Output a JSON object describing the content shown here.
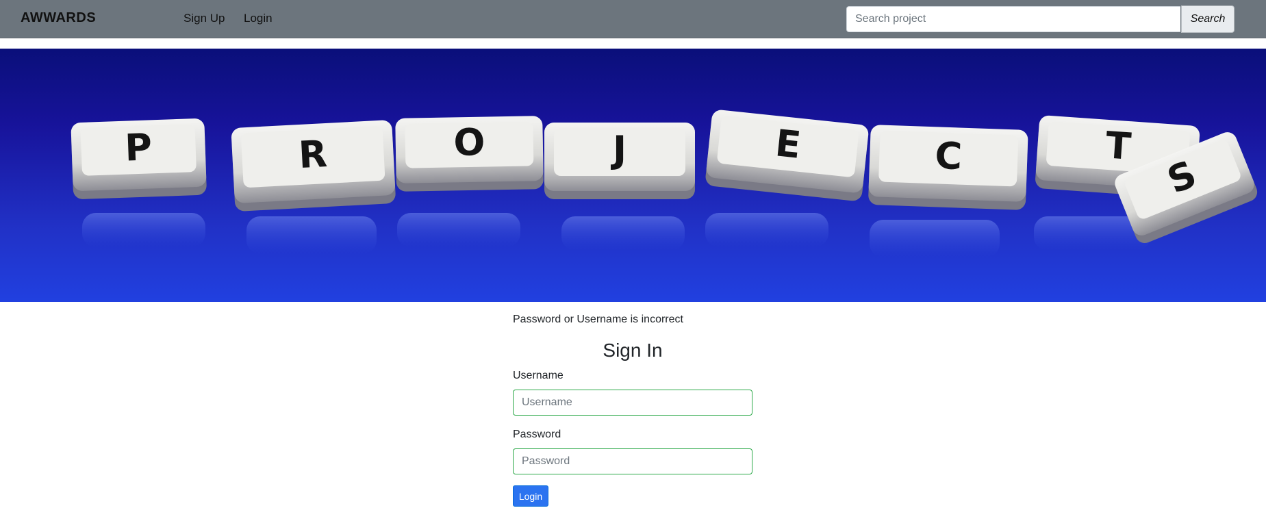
{
  "navbar": {
    "brand": "AWWARDS",
    "links": [
      {
        "label": "Sign Up"
      },
      {
        "label": "Login"
      }
    ],
    "search": {
      "placeholder": "Search project",
      "value": "",
      "button_label": "Search"
    }
  },
  "hero": {
    "keys": [
      "P",
      "R",
      "O",
      "J",
      "E",
      "C",
      "T",
      "S"
    ]
  },
  "form": {
    "error_message": "Password or Username is incorrect",
    "title": "Sign In",
    "username": {
      "label": "Username",
      "placeholder": "Username",
      "value": ""
    },
    "password": {
      "label": "Password",
      "placeholder": "Password",
      "value": ""
    },
    "submit_label": "Login"
  },
  "colors": {
    "navbar_bg": "#6c757d",
    "input_border": "#28a745",
    "button_primary": "#2b73f0"
  }
}
